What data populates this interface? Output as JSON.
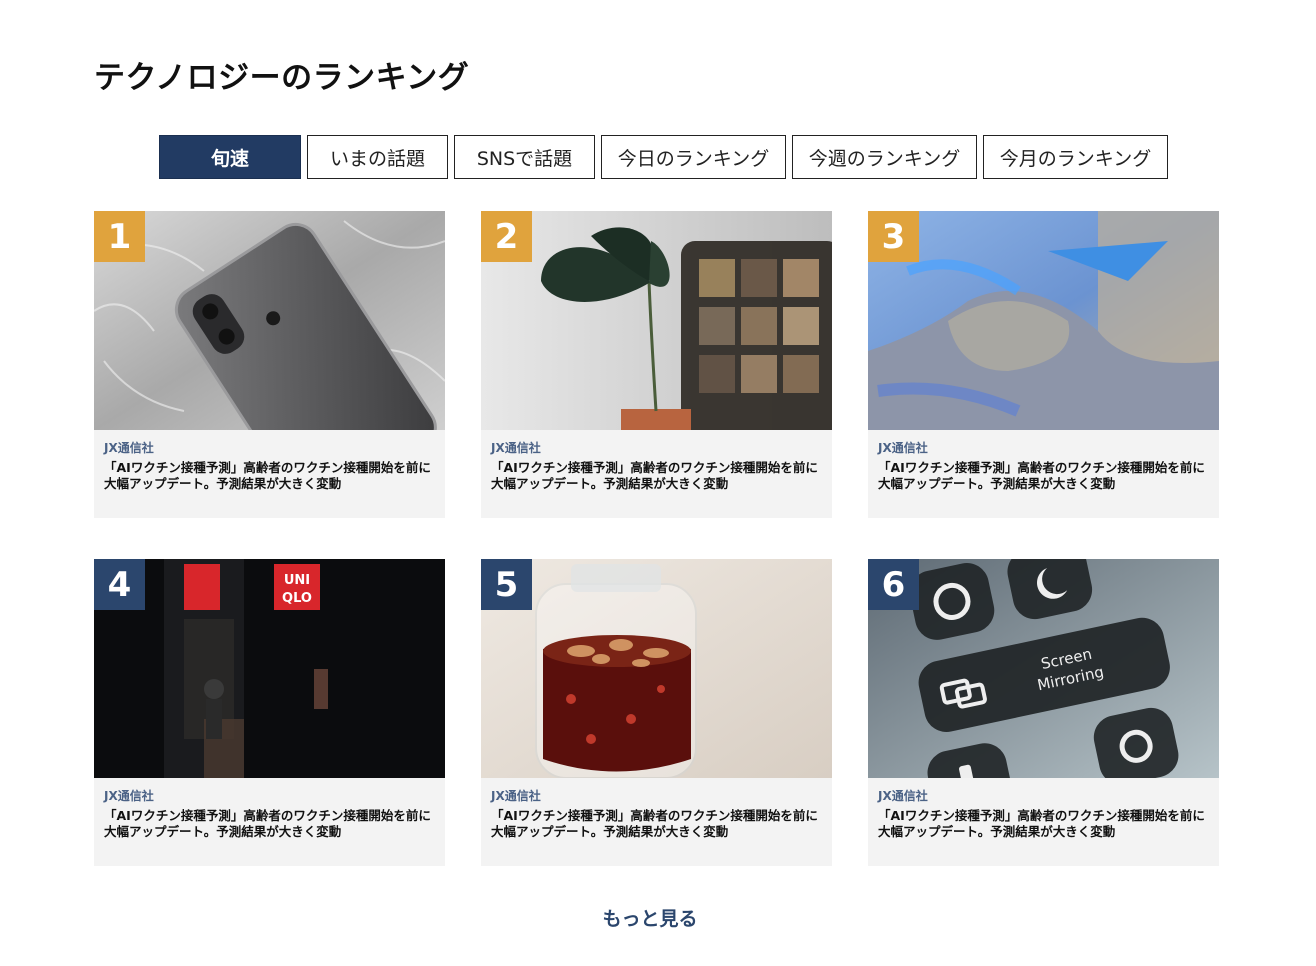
{
  "page": {
    "title": "テクノロジーのランキング"
  },
  "tabs": [
    {
      "label": "旬速",
      "active": true
    },
    {
      "label": "いまの話題",
      "active": false
    },
    {
      "label": "SNSで話題",
      "active": false
    },
    {
      "label": "今日のランキング",
      "active": false
    },
    {
      "label": "今週のランキング",
      "active": false
    },
    {
      "label": "今月のランキング",
      "active": false
    }
  ],
  "cards": [
    {
      "rank": "1",
      "source": "JX通信社",
      "headline": "「AIワクチン接種予測」高齢者のワクチン接種開始を前に大幅アップデート。予測結果が大きく変動",
      "image": "iphone-on-fur"
    },
    {
      "rank": "2",
      "source": "JX通信社",
      "headline": "「AIワクチン接種予測」高齢者のワクチン接種開始を前に大幅アップデート。予測結果が大きく変動",
      "image": "monstera-and-video-call"
    },
    {
      "rank": "3",
      "source": "JX通信社",
      "headline": "「AIワクチン接種予測」高齢者のワクチン接種開始を前に大幅アップデート。予測結果が大きく変動",
      "image": "blue-sand"
    },
    {
      "rank": "4",
      "source": "JX通信社",
      "headline": "「AIワクチン接種予測」高齢者のワクチン接種開始を前に大幅アップデート。予測結果が大きく変動",
      "image": "uniqlo-storefront-night",
      "sign_text": [
        "UNI",
        "QLO"
      ]
    },
    {
      "rank": "5",
      "source": "JX通信社",
      "headline": "「AIワクチン接種予測」高齢者のワクチン接種開始を前に大幅アップデート。予測結果が大きく変動",
      "image": "fruit-syrup-jar"
    },
    {
      "rank": "6",
      "source": "JX通信社",
      "headline": "「AIワクチン接種予測」高齢者のワクチン接種開始を前に大幅アップデート。予測結果が大きく変動",
      "image": "control-center-screen-mirroring",
      "screen_text": [
        "Screen",
        "Mirroring"
      ]
    }
  ],
  "more": {
    "label": "もっと見る"
  },
  "colors": {
    "accent": "#223b63",
    "rank_gold": "#e0a33d",
    "rank_navy": "#2b466d",
    "source": "#4b6286",
    "card_bg": "#f3f3f3"
  }
}
